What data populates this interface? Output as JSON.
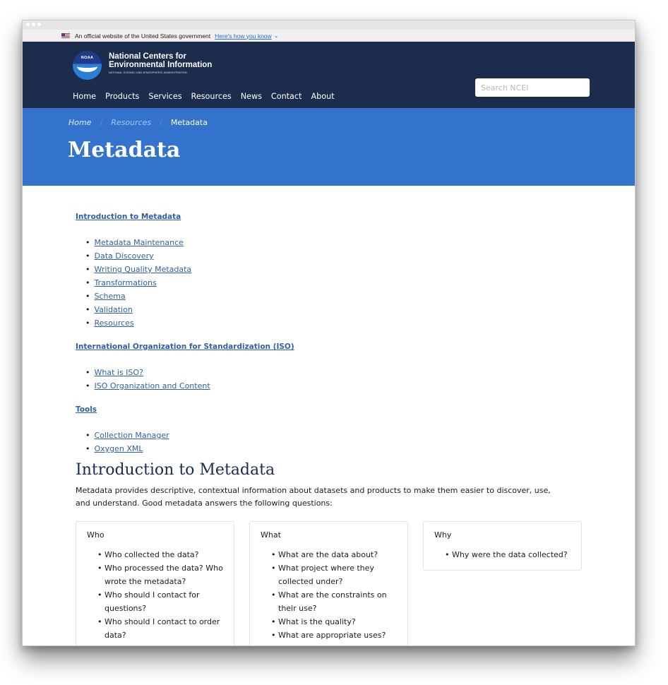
{
  "gov_banner": {
    "text": "An official website of the United States government",
    "link": "Here's how you know"
  },
  "header": {
    "logo_text": "NOAA",
    "brand_line1": "National Centers for",
    "brand_line2": "Environmental Information",
    "brand_sub": "NATIONAL OCEANIC AND ATMOSPHERIC ADMINISTRATION",
    "nav": [
      "Home",
      "Products",
      "Services",
      "Resources",
      "News",
      "Contact",
      "About"
    ],
    "search_placeholder": "Search NCEI"
  },
  "hero": {
    "breadcrumb": [
      "Home",
      "Resources",
      "Metadata"
    ],
    "title": "Metadata"
  },
  "toc": [
    {
      "heading": "Introduction to Metadata",
      "items": [
        "Metadata Maintenance",
        "Data Discovery",
        "Writing Quality Metadata",
        "Transformations",
        "Schema",
        "Validation",
        "Resources"
      ]
    },
    {
      "heading": "International Organization for Standardization (ISO)",
      "items": [
        "What is ISO?",
        "ISO Organization and Content"
      ]
    },
    {
      "heading": "Tools",
      "items": [
        "Collection Manager",
        "Oxygen XML"
      ]
    }
  ],
  "intro": {
    "title": "Introduction to Metadata",
    "text": "Metadata provides descriptive, contextual information about datasets and products to make them easier to discover, use, and understand. Good metadata answers the following questions:"
  },
  "cards": [
    {
      "title": "Who",
      "items": [
        "Who collected the data?",
        "Who processed the data? Who wrote the metadata?",
        "Who should I contact for questions?",
        "Who should I contact to order data?"
      ]
    },
    {
      "title": "What",
      "items": [
        "What are the data about?",
        "What project where they collected under?",
        "What are the constraints on their use?",
        "What is the quality?",
        "What are appropriate uses?"
      ]
    },
    {
      "title": "Why",
      "items": [
        "Why were the data collected?"
      ]
    }
  ]
}
